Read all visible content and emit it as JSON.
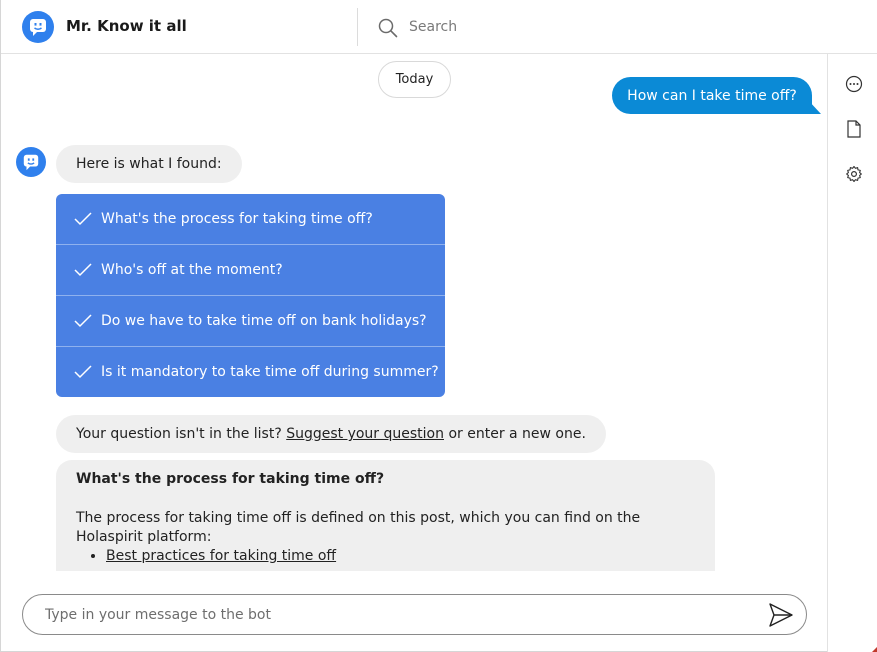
{
  "header": {
    "app_title": "Mr. Know it all",
    "search_placeholder": "Search"
  },
  "colors": {
    "brand": "#2f80ed",
    "user_bubble": "#0b8ad6",
    "suggestion_bg": "#4a80e3",
    "bot_bubble": "#efefef"
  },
  "right_rail": {
    "icons": [
      "more-options-icon",
      "document-icon",
      "settings-icon"
    ]
  },
  "chat": {
    "date_label": "Today",
    "user_message": "How can I take time off?",
    "bot_intro": "Here is what I found:",
    "suggestions": [
      "What's the process for taking time off?",
      "Who's off at the moment?",
      "Do we have to take time off on bank holidays?",
      "Is it mandatory to take time off during summer?"
    ],
    "not_listed": {
      "prefix": "Your question isn't in the list?",
      "link": "Suggest your question",
      "suffix": "or enter a new one."
    },
    "answer": {
      "title": "What's the process for taking time off?",
      "body": "The process for taking time off is defined on this post, which you can find on the Holaspirit platform:",
      "links": [
        "Best practices for taking time off"
      ]
    }
  },
  "composer": {
    "placeholder": "Type in your message to the bot"
  }
}
